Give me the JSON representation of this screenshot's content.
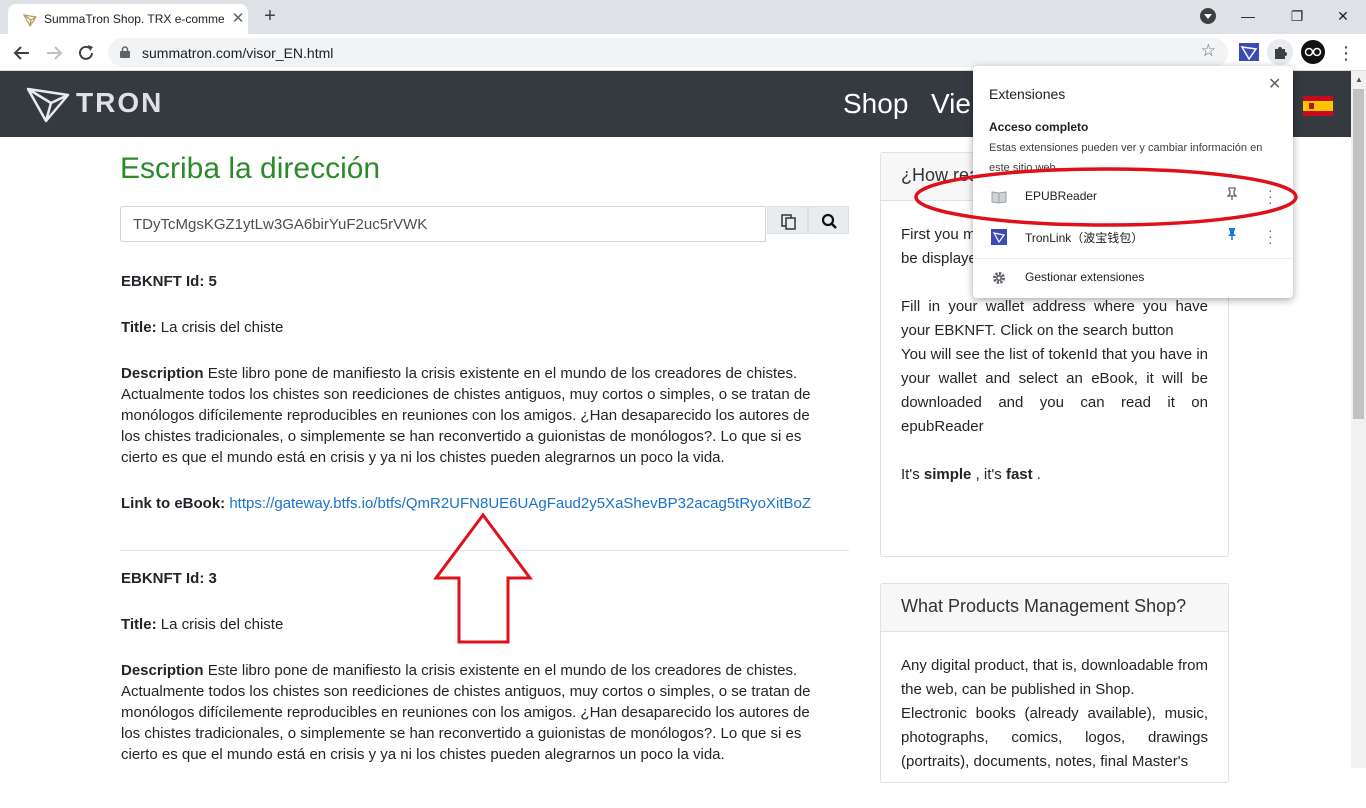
{
  "browser": {
    "tab_title": "SummaTron Shop. TRX e-comme",
    "tab_close": "✕",
    "new_tab": "+",
    "url": "summatron.com/visor_EN.html",
    "window_controls": {
      "minimize": "—",
      "maximize": "❐",
      "close": "✕"
    }
  },
  "site": {
    "logo_text": "TRON",
    "nav": [
      "Shop",
      "Vie"
    ],
    "language_flag": "es-flag"
  },
  "main": {
    "heading": "Escriba la dirección",
    "address_value": "TDyTcMgsKGZ1ytLw3GA6birYuF2uc5rVWK",
    "records": [
      {
        "id_label": "EBKNFT Id: 5",
        "title_label": "Title:",
        "title_value": "La crisis del chiste",
        "desc_label": "Description",
        "desc_value": "Este libro pone de manifiesto la crisis existente en el mundo de los creadores de chistes. Actualmente todos los chistes son reediciones de chistes antiguos, muy cortos o simples, o se tratan de monólogos difícilemente reproducibles en reuniones con los amigos. ¿Han desaparecido los autores de los chistes tradicionales, o simplemente se han reconvertido a guionistas de monólogos?. Lo que si es cierto es que el mundo está en crisis y ya ni los chistes pueden alegrarnos un poco la vida.",
        "link_label": "Link to eBook:",
        "link_value": "https://gateway.btfs.io/btfs/QmR2UFN8UE6UAgFaud2y5XaShevBP32acag5tRyoXitBoZ"
      },
      {
        "id_label": "EBKNFT Id: 3",
        "title_label": "Title:",
        "title_value": "La crisis del chiste",
        "desc_label": "Description",
        "desc_value": "Este libro pone de manifiesto la crisis existente en el mundo de los creadores de chistes. Actualmente todos los chistes son reediciones de chistes antiguos, muy cortos o simples, o se tratan de monólogos difícilemente reproducibles en reuniones con los amigos. ¿Han desaparecido los autores de los chistes tradicionales, o simplemente se han reconvertido a guionistas de monólogos?. Lo que si es cierto es que el mundo está en crisis y ya ni los chistes pueden alegrarnos un poco la vida."
      }
    ]
  },
  "sidebar": {
    "card1": {
      "title": "¿How rea",
      "p1": "First you m on your co install EPU eBooks will be displayed in your browser",
      "p2": "Fill in your wallet address where you have your EBKNFT. Click on the search button",
      "p3": "You will see the list of tokenId that you have in your wallet and select an eBook, it will be downloaded and you can read it on epubReader",
      "p4_pre": "It's ",
      "p4_simple": "simple",
      "p4_mid": " , it's ",
      "p4_fast": "fast",
      "p4_post": " ."
    },
    "card2": {
      "title": "What Products Management Shop?",
      "p1": "Any digital product, that is, downloadable from the web, can be published in Shop.",
      "p2": "Electronic books (already available), music, photographs, comics, logos, drawings (portraits), documents, notes, final Master's"
    }
  },
  "extensions_popup": {
    "title": "Extensiones",
    "close": "✕",
    "subtitle": "Acceso completo",
    "description": "Estas extensiones pueden ver y cambiar información en este sitio web",
    "items": [
      {
        "name": "EPUBReader",
        "pinned": false
      },
      {
        "name": "TronLink（波宝钱包）",
        "pinned": true
      }
    ],
    "manage": "Gestionar extensiones"
  },
  "colors": {
    "header_bg": "#343a40",
    "heading_green": "#2c8a2c",
    "link_blue": "#1a73c8",
    "annotation_red": "#e0101a"
  }
}
